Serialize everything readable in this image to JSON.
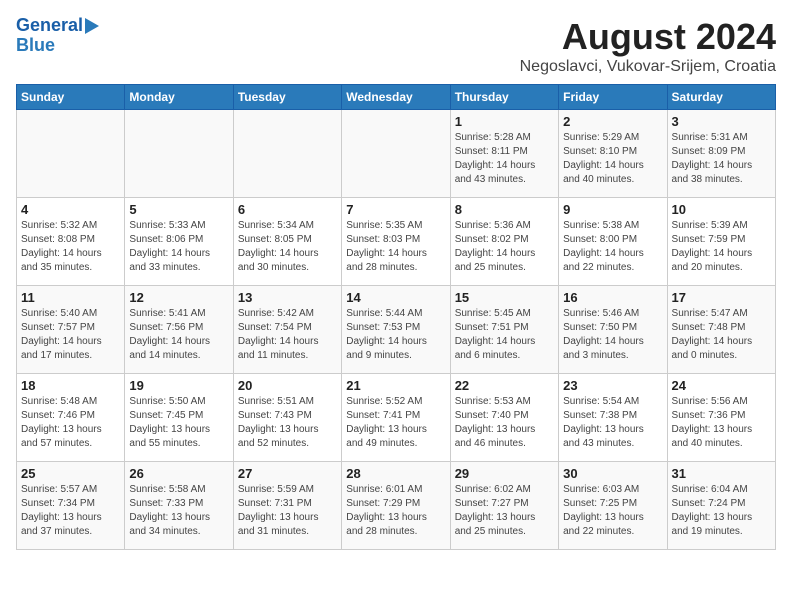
{
  "header": {
    "logo_line1": "General",
    "logo_line2": "Blue",
    "title": "August 2024",
    "subtitle": "Negoslavci, Vukovar-Srijem, Croatia"
  },
  "calendar": {
    "days_of_week": [
      "Sunday",
      "Monday",
      "Tuesday",
      "Wednesday",
      "Thursday",
      "Friday",
      "Saturday"
    ],
    "weeks": [
      [
        {
          "day": "",
          "content": ""
        },
        {
          "day": "",
          "content": ""
        },
        {
          "day": "",
          "content": ""
        },
        {
          "day": "",
          "content": ""
        },
        {
          "day": "1",
          "content": "Sunrise: 5:28 AM\nSunset: 8:11 PM\nDaylight: 14 hours\nand 43 minutes."
        },
        {
          "day": "2",
          "content": "Sunrise: 5:29 AM\nSunset: 8:10 PM\nDaylight: 14 hours\nand 40 minutes."
        },
        {
          "day": "3",
          "content": "Sunrise: 5:31 AM\nSunset: 8:09 PM\nDaylight: 14 hours\nand 38 minutes."
        }
      ],
      [
        {
          "day": "4",
          "content": "Sunrise: 5:32 AM\nSunset: 8:08 PM\nDaylight: 14 hours\nand 35 minutes."
        },
        {
          "day": "5",
          "content": "Sunrise: 5:33 AM\nSunset: 8:06 PM\nDaylight: 14 hours\nand 33 minutes."
        },
        {
          "day": "6",
          "content": "Sunrise: 5:34 AM\nSunset: 8:05 PM\nDaylight: 14 hours\nand 30 minutes."
        },
        {
          "day": "7",
          "content": "Sunrise: 5:35 AM\nSunset: 8:03 PM\nDaylight: 14 hours\nand 28 minutes."
        },
        {
          "day": "8",
          "content": "Sunrise: 5:36 AM\nSunset: 8:02 PM\nDaylight: 14 hours\nand 25 minutes."
        },
        {
          "day": "9",
          "content": "Sunrise: 5:38 AM\nSunset: 8:00 PM\nDaylight: 14 hours\nand 22 minutes."
        },
        {
          "day": "10",
          "content": "Sunrise: 5:39 AM\nSunset: 7:59 PM\nDaylight: 14 hours\nand 20 minutes."
        }
      ],
      [
        {
          "day": "11",
          "content": "Sunrise: 5:40 AM\nSunset: 7:57 PM\nDaylight: 14 hours\nand 17 minutes."
        },
        {
          "day": "12",
          "content": "Sunrise: 5:41 AM\nSunset: 7:56 PM\nDaylight: 14 hours\nand 14 minutes."
        },
        {
          "day": "13",
          "content": "Sunrise: 5:42 AM\nSunset: 7:54 PM\nDaylight: 14 hours\nand 11 minutes."
        },
        {
          "day": "14",
          "content": "Sunrise: 5:44 AM\nSunset: 7:53 PM\nDaylight: 14 hours\nand 9 minutes."
        },
        {
          "day": "15",
          "content": "Sunrise: 5:45 AM\nSunset: 7:51 PM\nDaylight: 14 hours\nand 6 minutes."
        },
        {
          "day": "16",
          "content": "Sunrise: 5:46 AM\nSunset: 7:50 PM\nDaylight: 14 hours\nand 3 minutes."
        },
        {
          "day": "17",
          "content": "Sunrise: 5:47 AM\nSunset: 7:48 PM\nDaylight: 14 hours\nand 0 minutes."
        }
      ],
      [
        {
          "day": "18",
          "content": "Sunrise: 5:48 AM\nSunset: 7:46 PM\nDaylight: 13 hours\nand 57 minutes."
        },
        {
          "day": "19",
          "content": "Sunrise: 5:50 AM\nSunset: 7:45 PM\nDaylight: 13 hours\nand 55 minutes."
        },
        {
          "day": "20",
          "content": "Sunrise: 5:51 AM\nSunset: 7:43 PM\nDaylight: 13 hours\nand 52 minutes."
        },
        {
          "day": "21",
          "content": "Sunrise: 5:52 AM\nSunset: 7:41 PM\nDaylight: 13 hours\nand 49 minutes."
        },
        {
          "day": "22",
          "content": "Sunrise: 5:53 AM\nSunset: 7:40 PM\nDaylight: 13 hours\nand 46 minutes."
        },
        {
          "day": "23",
          "content": "Sunrise: 5:54 AM\nSunset: 7:38 PM\nDaylight: 13 hours\nand 43 minutes."
        },
        {
          "day": "24",
          "content": "Sunrise: 5:56 AM\nSunset: 7:36 PM\nDaylight: 13 hours\nand 40 minutes."
        }
      ],
      [
        {
          "day": "25",
          "content": "Sunrise: 5:57 AM\nSunset: 7:34 PM\nDaylight: 13 hours\nand 37 minutes."
        },
        {
          "day": "26",
          "content": "Sunrise: 5:58 AM\nSunset: 7:33 PM\nDaylight: 13 hours\nand 34 minutes."
        },
        {
          "day": "27",
          "content": "Sunrise: 5:59 AM\nSunset: 7:31 PM\nDaylight: 13 hours\nand 31 minutes."
        },
        {
          "day": "28",
          "content": "Sunrise: 6:01 AM\nSunset: 7:29 PM\nDaylight: 13 hours\nand 28 minutes."
        },
        {
          "day": "29",
          "content": "Sunrise: 6:02 AM\nSunset: 7:27 PM\nDaylight: 13 hours\nand 25 minutes."
        },
        {
          "day": "30",
          "content": "Sunrise: 6:03 AM\nSunset: 7:25 PM\nDaylight: 13 hours\nand 22 minutes."
        },
        {
          "day": "31",
          "content": "Sunrise: 6:04 AM\nSunset: 7:24 PM\nDaylight: 13 hours\nand 19 minutes."
        }
      ]
    ]
  }
}
